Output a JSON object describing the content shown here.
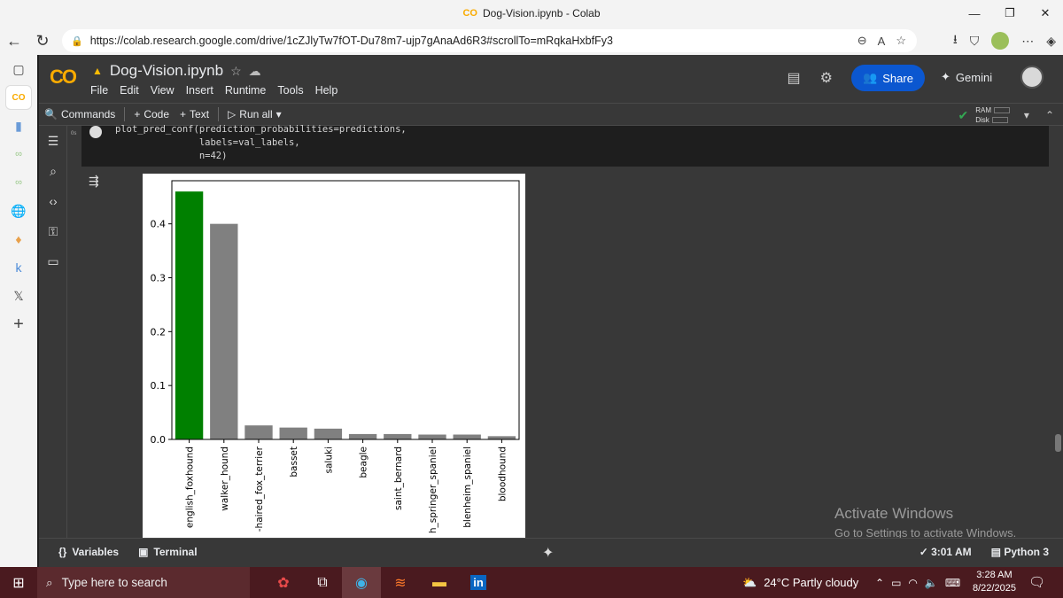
{
  "browser": {
    "window_title": "Dog-Vision.ipynb - Colab",
    "tab_logo": "CO",
    "url": "https://colab.research.google.com/drive/1cZJlyTw7fOT-Du78m7-ujp7gAnaAd6R3#scrollTo=mRqkaHxbfFy3",
    "controls": {
      "minimize": "—",
      "restore": "❐",
      "close": "✕"
    }
  },
  "colab": {
    "logo": "CO",
    "notebook_name": "Dog-Vision.ipynb",
    "menu": [
      "File",
      "Edit",
      "View",
      "Insert",
      "Runtime",
      "Tools",
      "Help"
    ],
    "share_label": "Share",
    "gemini_label": "Gemini",
    "toolbar": {
      "commands": "Commands",
      "code": "Code",
      "text": "Text",
      "run_all": "Run all"
    },
    "resources": {
      "ram": "RAM",
      "disk": "Disk"
    },
    "code_lines": [
      "plot_pred_conf(prediction_probabilities=predictions,",
      "               labels=val_labels,",
      "               n=42)"
    ],
    "exec_time": "0s",
    "status": {
      "variables": "Variables",
      "terminal": "Terminal",
      "time": "3:01 AM",
      "runtime": "Python 3"
    }
  },
  "watermark": {
    "line1": "Activate Windows",
    "line2": "Go to Settings to activate Windows."
  },
  "taskbar": {
    "search_placeholder": "Type here to search",
    "weather": "24°C  Partly cloudy",
    "time": "3:28 AM",
    "date": "8/22/2025"
  },
  "chart_data": {
    "type": "bar",
    "categories": [
      "english_foxhound",
      "walker_hound",
      "-haired_fox_terrier",
      "basset",
      "saluki",
      "beagle",
      "saint_bernard",
      "h_springer_spaniel",
      "blenheim_spaniel",
      "bloodhound"
    ],
    "values": [
      0.46,
      0.4,
      0.026,
      0.022,
      0.02,
      0.01,
      0.01,
      0.009,
      0.009,
      0.006
    ],
    "colors": [
      "#008000",
      "#808080",
      "#808080",
      "#808080",
      "#808080",
      "#808080",
      "#808080",
      "#808080",
      "#808080",
      "#808080"
    ],
    "yticks": [
      "0.0",
      "0.1",
      "0.2",
      "0.3",
      "0.4"
    ],
    "ylim": [
      0,
      0.48
    ],
    "title": "",
    "xlabel": "",
    "ylabel": ""
  }
}
